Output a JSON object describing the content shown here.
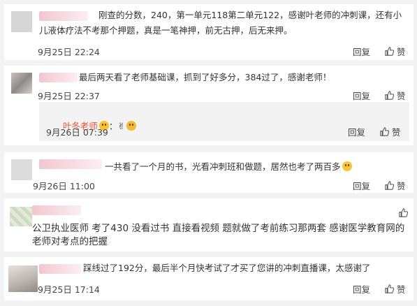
{
  "comments": [
    {
      "text": "刚查的分数，240，第一单元118第二单元122，感谢叶老师的冲刺课，还有小儿液体疗法不考那个押题，真是一笔神押，前无古押，后无来押。",
      "time": "9月25日 22:24",
      "reply": "回复",
      "like": "赞"
    },
    {
      "text": "最后两天看了老师基础课，抓到了好多分，384过了，感谢老师！",
      "time": "9月25日 22:37",
      "reply": "回复",
      "like": "赞",
      "sub": {
        "name": "叶冬老师",
        "colon": "：",
        "time": "9月26日 07:39",
        "reply": "回复",
        "like": "赞"
      }
    },
    {
      "text": "一共看了一个月的书，光看冲刺班和做题，居然也考了两百多",
      "time": "9月26日 11:00",
      "reply": "回复",
      "like": "赞"
    },
    {
      "text": "公卫执业医师 考了430 没看过书 直接看视频 题就做了考前练习那两套 感谢医学教育网的老师对考点的把握"
    },
    {
      "text": "踩线过了192分，最后半个月快考试了才买了您讲的冲刺直播课，太感谢了",
      "time": "9月25日 17:14",
      "reply": "回复",
      "like": "赞"
    }
  ],
  "colors": {
    "background": "#f3f3f3",
    "card": "#ffffff",
    "teacher": "#e8553d"
  },
  "icons": [
    "avatar",
    "thumbs-up-icon",
    "emoji-icon"
  ]
}
